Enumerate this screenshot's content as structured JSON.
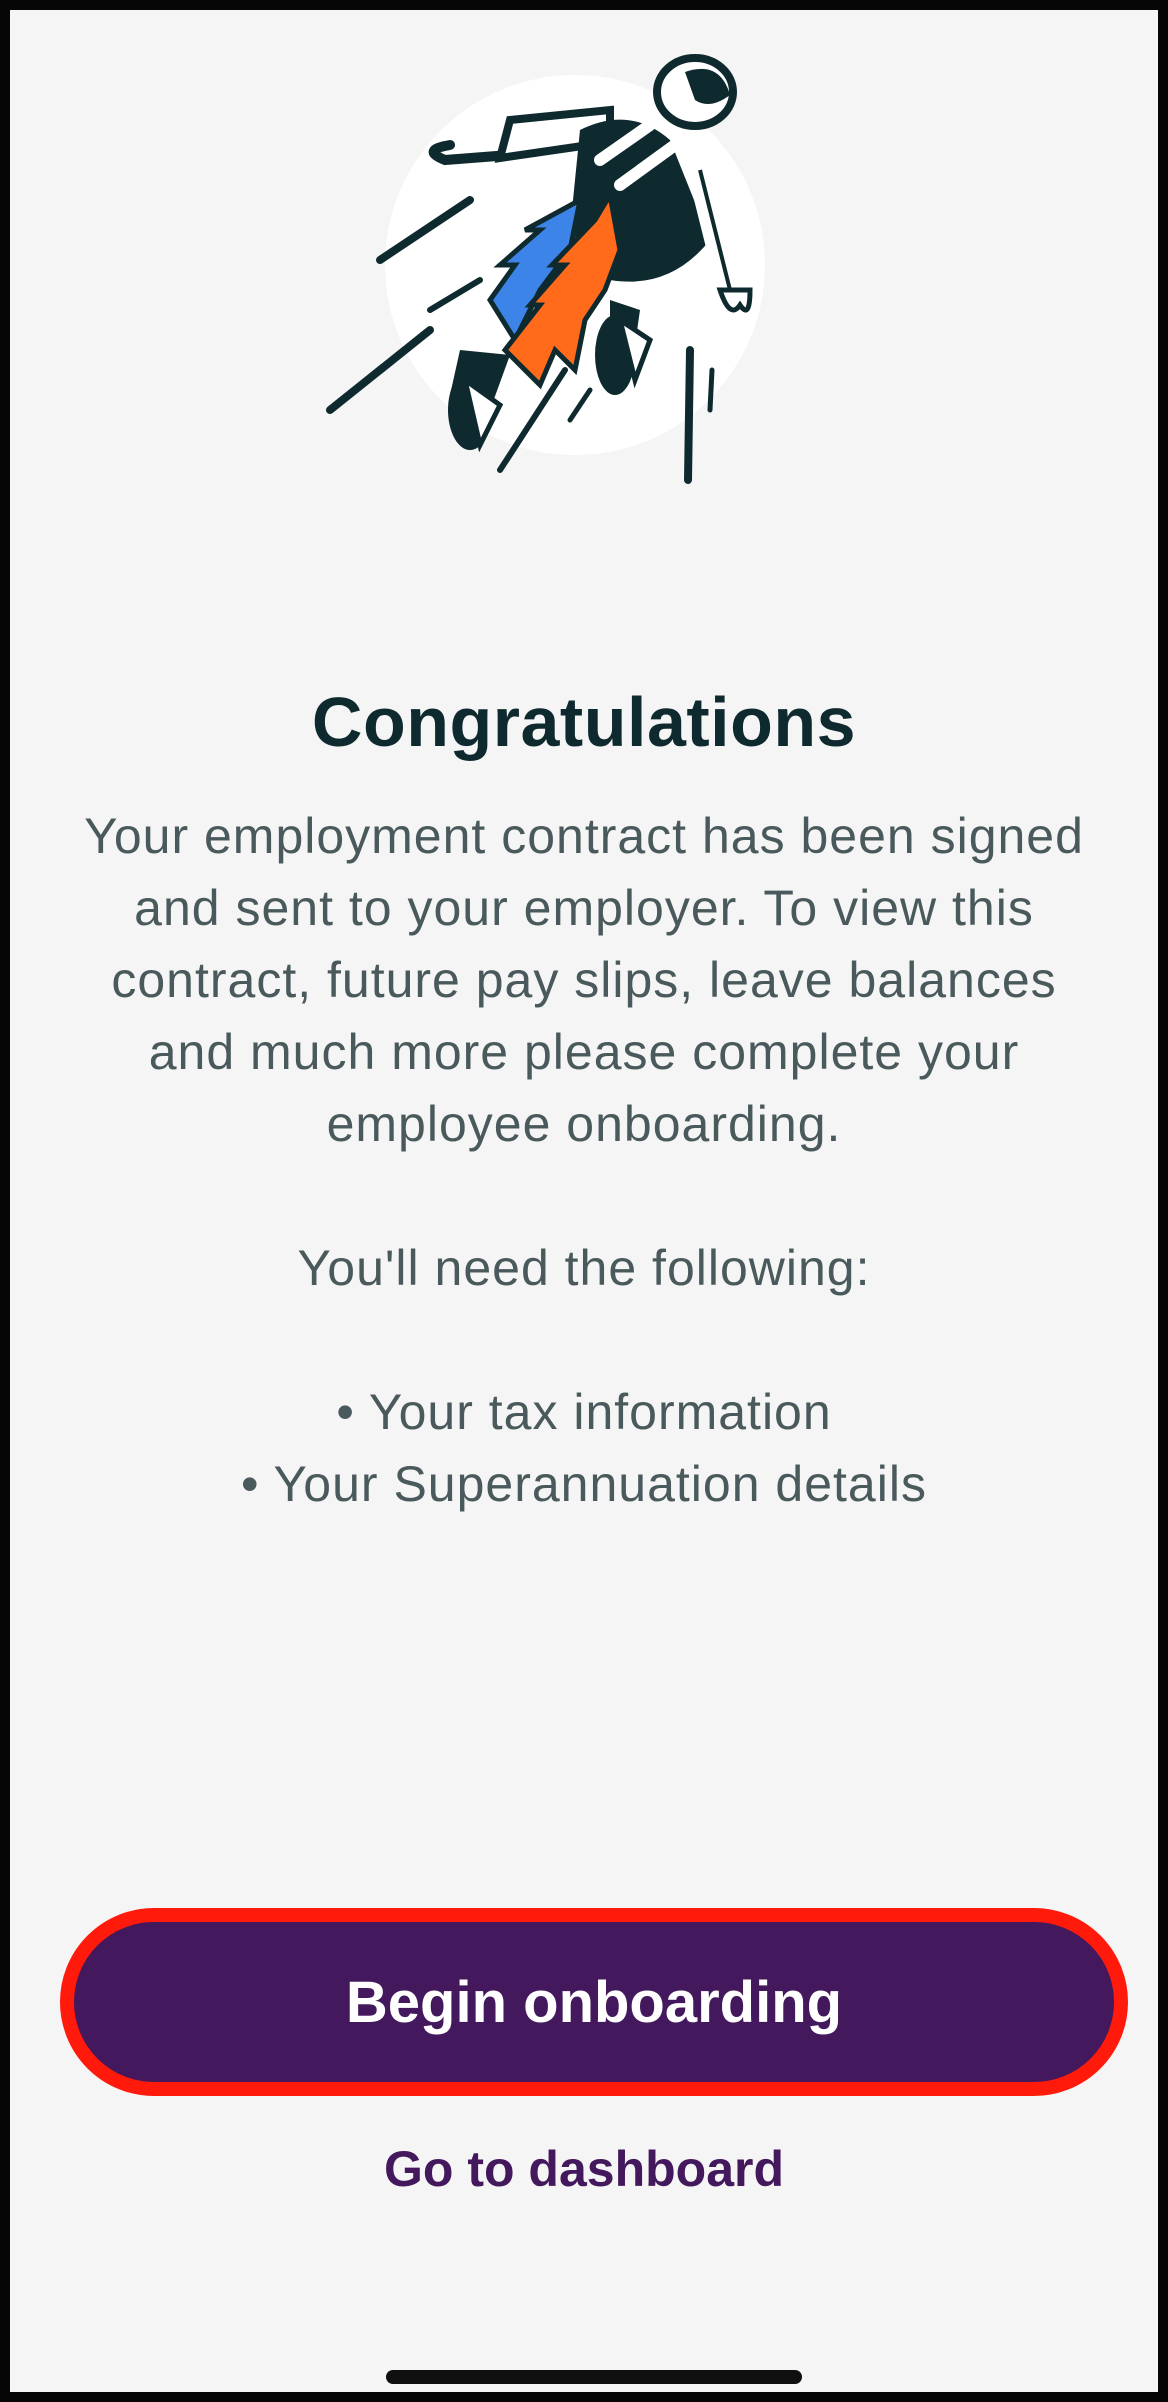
{
  "title": "Congratulations",
  "description": {
    "paragraph": "Your employment contract has been signed and sent to your employer. To view this contract, future pay slips, leave balances and much more please complete your employee onboarding.",
    "need_heading": "You'll need the following:",
    "items": [
      "• Your tax information",
      "• Your Superannuation details"
    ]
  },
  "actions": {
    "primary_label": "Begin onboarding",
    "secondary_label": "Go to dashboard"
  },
  "icons": {
    "hero": "jetpack-person-illustration-icon"
  },
  "colors": {
    "primary": "#43185c",
    "highlight_outline": "#ff1a0b",
    "background": "#f5f5f5",
    "title": "#0f2a2f",
    "body_text": "#4a5a5c"
  }
}
